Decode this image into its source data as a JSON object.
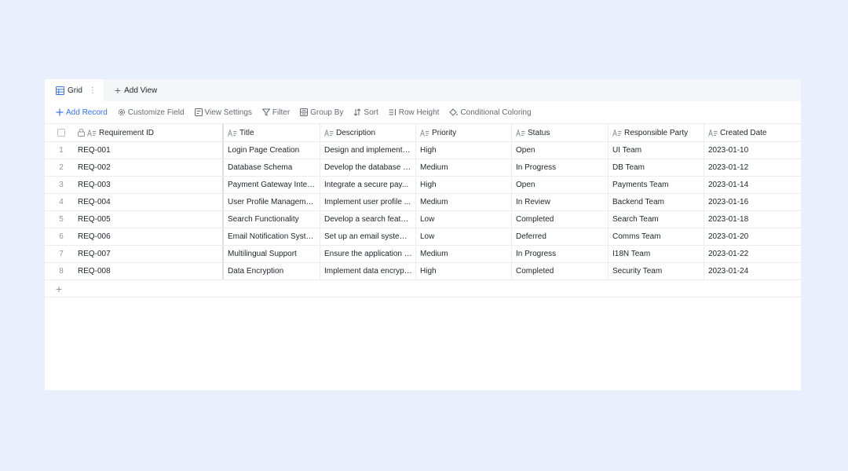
{
  "views": {
    "active_tab": "Grid",
    "more": "⋮",
    "add_view": "Add View"
  },
  "toolbar": {
    "add_record": "Add Record",
    "customize_field": "Customize Field",
    "view_settings": "View Settings",
    "filter": "Filter",
    "group_by": "Group By",
    "sort": "Sort",
    "row_height": "Row Height",
    "conditional_coloring": "Conditional Coloring"
  },
  "columns": [
    "Requirement ID",
    "Title",
    "Description",
    "Priority",
    "Status",
    "Responsible Party",
    "Created Date"
  ],
  "rows": [
    {
      "idx": "1",
      "id": "REQ-001",
      "title": "Login Page Creation",
      "desc": "Design and implement a...",
      "priority": "High",
      "status": "Open",
      "party": "UI Team",
      "date": "2023-01-10"
    },
    {
      "idx": "2",
      "id": "REQ-002",
      "title": "Database Schema",
      "desc": "Develop the database sc...",
      "priority": "Medium",
      "status": "In Progress",
      "party": "DB Team",
      "date": "2023-01-12"
    },
    {
      "idx": "3",
      "id": "REQ-003",
      "title": "Payment Gateway Integ...",
      "desc": "Integrate a secure pay...",
      "priority": "High",
      "status": "Open",
      "party": "Payments Team",
      "date": "2023-01-14"
    },
    {
      "idx": "4",
      "id": "REQ-004",
      "title": "User Profile Management",
      "desc": "Implement user profile ...",
      "priority": "Medium",
      "status": "In Review",
      "party": "Backend Team",
      "date": "2023-01-16"
    },
    {
      "idx": "5",
      "id": "REQ-005",
      "title": "Search Functionality",
      "desc": "Develop a search featur...",
      "priority": "Low",
      "status": "Completed",
      "party": "Search Team",
      "date": "2023-01-18"
    },
    {
      "idx": "6",
      "id": "REQ-006",
      "title": "Email Notification System",
      "desc": "Set up an email system ...",
      "priority": "Low",
      "status": "Deferred",
      "party": "Comms Team",
      "date": "2023-01-20"
    },
    {
      "idx": "7",
      "id": "REQ-007",
      "title": "Multilingual Support",
      "desc": "Ensure the application s...",
      "priority": "Medium",
      "status": "In Progress",
      "party": "I18N Team",
      "date": "2023-01-22"
    },
    {
      "idx": "8",
      "id": "REQ-008",
      "title": "Data Encryption",
      "desc": "Implement data encrypt...",
      "priority": "High",
      "status": "Completed",
      "party": "Security Team",
      "date": "2023-01-24"
    }
  ],
  "add_row_symbol": "+",
  "colors": {
    "accent": "#3370ff",
    "background": "#e9effc"
  }
}
